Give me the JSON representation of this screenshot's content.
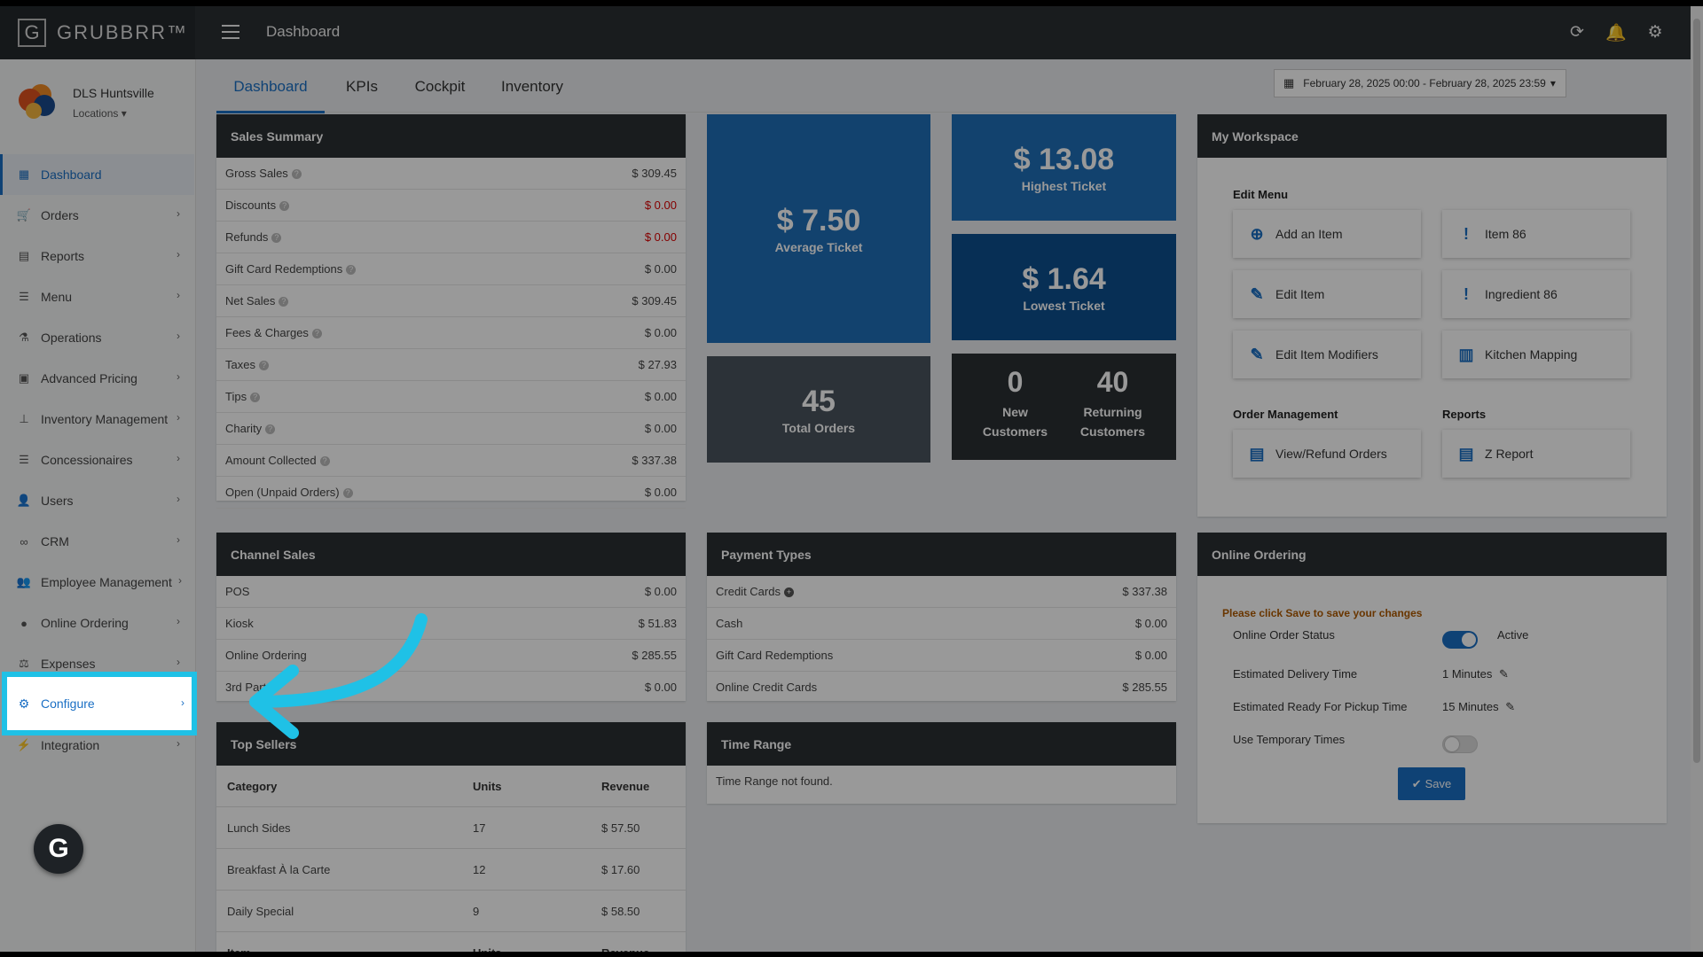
{
  "app": {
    "brand": "GRUBBRR™",
    "logo_letter": "G",
    "page_title": "Dashboard"
  },
  "topbar_icons": [
    "refresh-icon",
    "bell-icon",
    "gear-icon"
  ],
  "profile": {
    "name": "DLS Huntsville",
    "locations_label": "Locations"
  },
  "sidebar": {
    "items": [
      {
        "label": "Dashboard",
        "icon": "dashboard-icon"
      },
      {
        "label": "Orders",
        "icon": "cart-icon"
      },
      {
        "label": "Reports",
        "icon": "report-icon"
      },
      {
        "label": "Menu",
        "icon": "list-icon"
      },
      {
        "label": "Operations",
        "icon": "flask-icon"
      },
      {
        "label": "Advanced Pricing",
        "icon": "money-icon"
      },
      {
        "label": "Inventory Management",
        "icon": "sitemap-icon"
      },
      {
        "label": "Concessionaires",
        "icon": "list-icon"
      },
      {
        "label": "Users",
        "icon": "users-icon"
      },
      {
        "label": "CRM",
        "icon": "link-icon"
      },
      {
        "label": "Employee Management",
        "icon": "group-icon"
      },
      {
        "label": "Online Ordering",
        "icon": "globe-icon"
      },
      {
        "label": "Expenses",
        "icon": "scale-icon"
      },
      {
        "label": "Configure",
        "icon": "gear-icon"
      },
      {
        "label": "Integration",
        "icon": "plug-icon"
      }
    ]
  },
  "tabs": [
    "Dashboard",
    "KPIs",
    "Cockpit",
    "Inventory"
  ],
  "date_range": "February 28, 2025 00:00 - February 28, 2025 23:59",
  "sales_summary": {
    "title": "Sales Summary",
    "rows": [
      {
        "label": "Gross Sales",
        "value": "$ 309.45"
      },
      {
        "label": "Discounts",
        "value": "$ 0.00"
      },
      {
        "label": "Refunds",
        "value": "$ 0.00"
      },
      {
        "label": "Gift Card Redemptions",
        "value": "$ 0.00"
      },
      {
        "label": "Net Sales",
        "value": "$ 309.45"
      },
      {
        "label": "Fees & Charges",
        "value": "$ 0.00"
      },
      {
        "label": "Taxes",
        "value": "$ 27.93"
      },
      {
        "label": "Tips",
        "value": "$ 0.00"
      },
      {
        "label": "Charity",
        "value": "$ 0.00"
      },
      {
        "label": "Amount Collected",
        "value": "$ 337.38"
      },
      {
        "label": "Open (Unpaid Orders)",
        "value": "$ 0.00"
      }
    ]
  },
  "kpis": {
    "average_ticket": {
      "value": "$ 7.50",
      "label": "Average Ticket"
    },
    "highest_ticket": {
      "value": "$ 13.08",
      "label": "Highest Ticket"
    },
    "lowest_ticket": {
      "value": "$ 1.64",
      "label": "Lowest Ticket"
    },
    "total_orders": {
      "value": "45",
      "label": "Total Orders"
    },
    "new_customers": {
      "value": "0",
      "label": "New Customers"
    },
    "returning_customers": {
      "value": "40",
      "label": "Returning Customers"
    }
  },
  "workspace": {
    "title": "My Workspace",
    "edit_menu_label": "Edit Menu",
    "order_management_label": "Order Management",
    "reports_label": "Reports",
    "buttons": {
      "add_item": "Add an Item",
      "item86": "Item 86",
      "edit_item": "Edit Item",
      "ingredient86": "Ingredient 86",
      "edit_modifiers": "Edit Item Modifiers",
      "kitchen_mapping": "Kitchen Mapping",
      "view_refund": "View/Refund Orders",
      "z_report": "Z Report"
    }
  },
  "channel_sales": {
    "title": "Channel Sales",
    "rows": [
      {
        "label": "POS",
        "value": "$ 0.00"
      },
      {
        "label": "Kiosk",
        "value": "$ 51.83"
      },
      {
        "label": "Online Ordering",
        "value": "$ 285.55"
      },
      {
        "label": "3rd Part",
        "value": "$ 0.00"
      }
    ]
  },
  "payment_types": {
    "title": "Payment Types",
    "rows": [
      {
        "label": "Credit Cards",
        "value": "$ 337.38"
      },
      {
        "label": "Cash",
        "value": "$ 0.00"
      },
      {
        "label": "Gift Card Redemptions",
        "value": "$ 0.00"
      },
      {
        "label": "Online Credit Cards",
        "value": "$ 285.55"
      }
    ]
  },
  "online_ordering": {
    "title": "Online Ordering",
    "notice": "Please click Save to save your changes",
    "status_label": "Online Order Status",
    "status_value": "Active",
    "delivery_label": "Estimated Delivery Time",
    "delivery_value": "1 Minutes",
    "pickup_label": "Estimated Ready For Pickup Time",
    "pickup_value": "15 Minutes",
    "temp_label": "Use Temporary Times",
    "save_label": "Save"
  },
  "top_sellers": {
    "title": "Top Sellers",
    "headers": [
      "Category",
      "Units",
      "Revenue"
    ],
    "rows": [
      [
        "Lunch Sides",
        "17",
        "$ 57.50"
      ],
      [
        "Breakfast À la Carte",
        "12",
        "$ 17.60"
      ],
      [
        "Daily Special",
        "9",
        "$ 58.50"
      ]
    ],
    "headers2": [
      "Item",
      "Units",
      "Revenue"
    ]
  },
  "time_range": {
    "title": "Time Range",
    "message": "Time Range not found."
  },
  "colors": {
    "accent": "#1a6fc4",
    "highlight": "#1fc1e6",
    "kpi_blue": "#1f6fb8",
    "kpi_navy": "#0d4f8e",
    "kpi_dark": "#4a545e",
    "negative": "#dd0000"
  }
}
